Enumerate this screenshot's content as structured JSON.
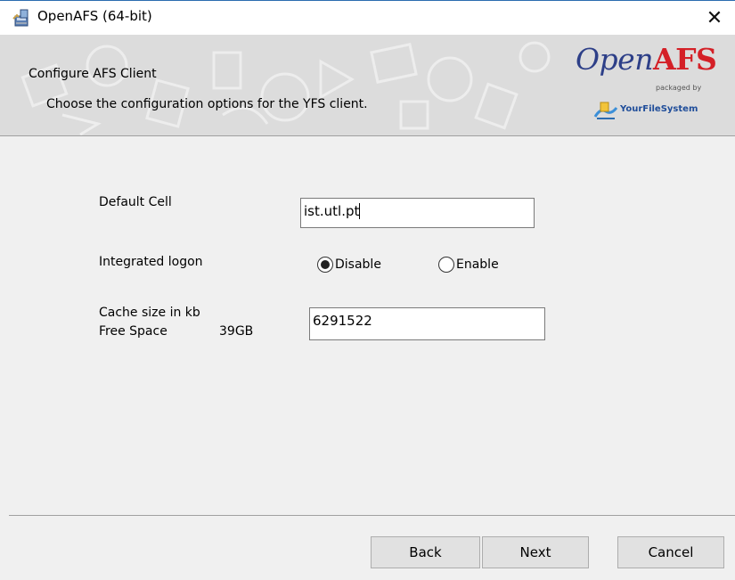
{
  "window": {
    "title": "OpenAFS (64-bit)",
    "close_glyph": "✕"
  },
  "banner": {
    "title": "Configure AFS Client",
    "subtitle": "Choose the configuration options for the YFS client.",
    "logo": {
      "open": "Open",
      "afs": "AFS",
      "packaged_by": "packaged by",
      "vendor": "YourFileSystem"
    }
  },
  "form": {
    "default_cell_label": "Default Cell",
    "default_cell_value": "ist.utl.pt",
    "integrated_logon_label": "Integrated logon",
    "radio_disable_label": "Disable",
    "radio_enable_label": "Enable",
    "integrated_logon_selected": "Disable",
    "cache_size_label": "Cache size in kb",
    "free_space_label": "Free Space",
    "free_space_value": "39GB",
    "cache_size_value": "6291522"
  },
  "buttons": {
    "back": "Back",
    "next": "Next",
    "cancel": "Cancel"
  },
  "colors": {
    "window_border": "#2b6cb0",
    "logo_blue": "#2d3f88",
    "logo_red": "#d42027"
  },
  "icons": {
    "app": "openafs-installer-icon",
    "close": "close-icon",
    "vendor": "yourfilesystem-logo-icon"
  }
}
